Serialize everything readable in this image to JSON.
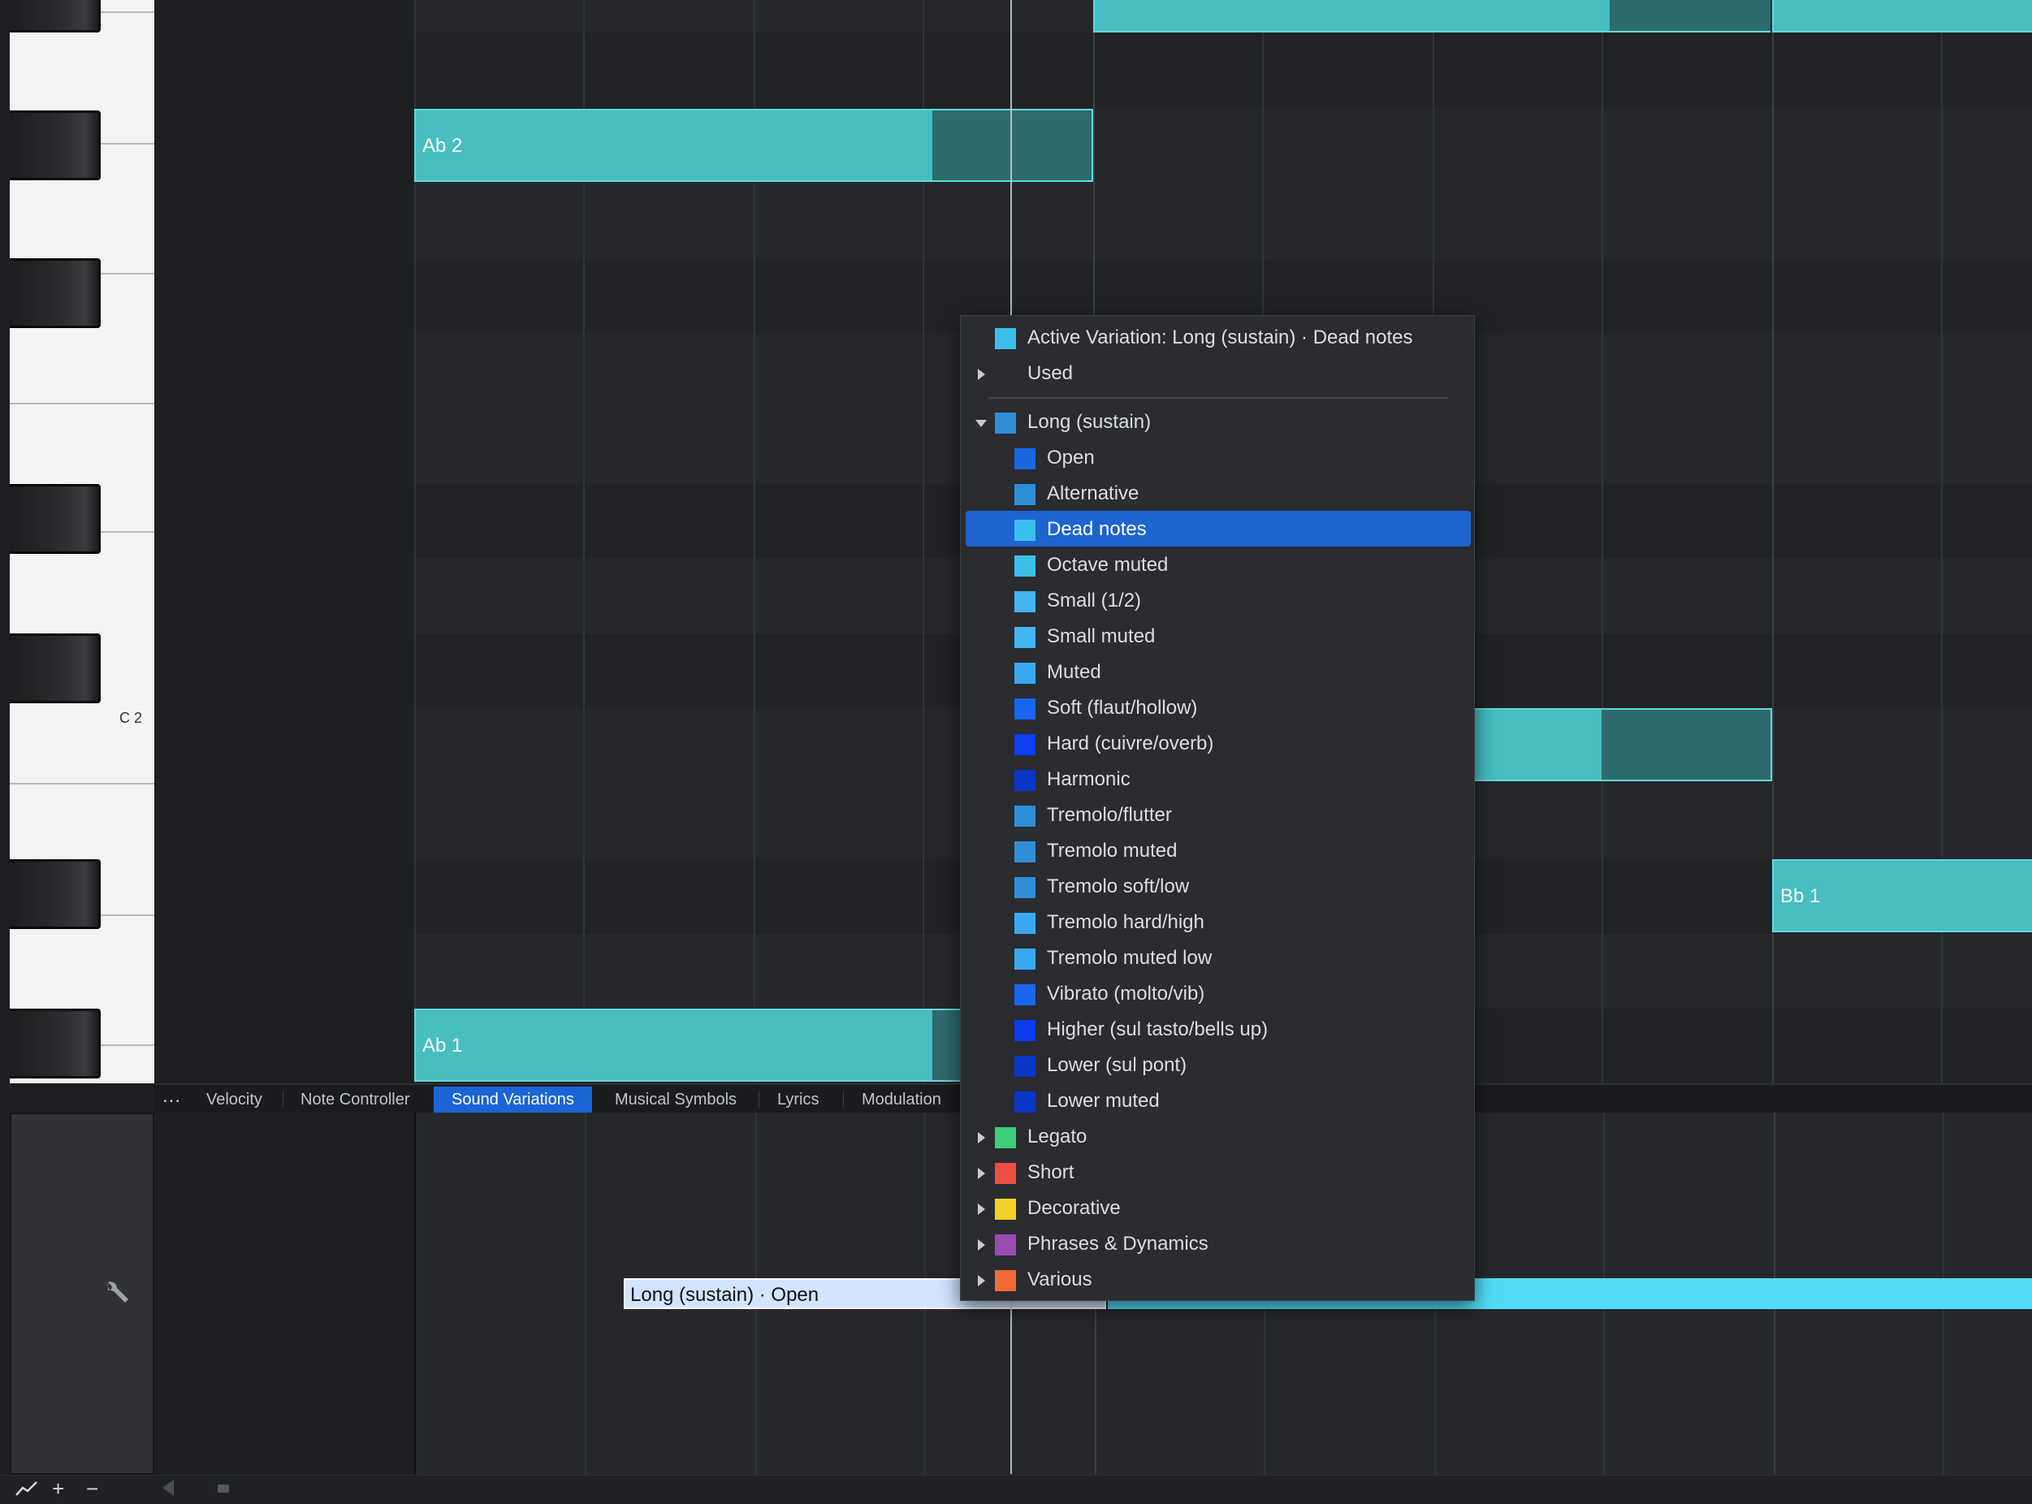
{
  "keyboard": {
    "c2_label": "C 2"
  },
  "notes": [
    {
      "label": "Ab 2",
      "pitch": "Ab 2"
    },
    {
      "label": "Ab 1",
      "pitch": "Ab 1"
    },
    {
      "label": "Bb 1",
      "pitch": "Bb 1"
    }
  ],
  "tabs": {
    "more": "...",
    "items": [
      "Velocity",
      "Note Controller",
      "Sound Variations",
      "Musical Symbols",
      "Lyrics",
      "Modulation"
    ],
    "active": "Sound Variations"
  },
  "lane": {
    "segment_a_label": "Long (sustain) · Open"
  },
  "menu": {
    "active_variation": "Active Variation: Long (sustain) · Dead notes",
    "used": "Used",
    "group_open": "Long (sustain)",
    "selected": "Dead notes",
    "sub_items": [
      {
        "label": "Open",
        "color": "#1a66e0"
      },
      {
        "label": "Alternative",
        "color": "#2e8ed6"
      },
      {
        "label": "Dead notes",
        "color": "#3cc0ea"
      },
      {
        "label": "Octave muted",
        "color": "#3cc0ea"
      },
      {
        "label": "Small (1/2)",
        "color": "#44b4f2"
      },
      {
        "label": "Small muted",
        "color": "#44b4f2"
      },
      {
        "label": "Muted",
        "color": "#3aa8f0"
      },
      {
        "label": "Soft (flaut/hollow)",
        "color": "#1566f0"
      },
      {
        "label": "Hard (cuivre/overb)",
        "color": "#0c3ef2"
      },
      {
        "label": "Harmonic",
        "color": "#0a36c8"
      },
      {
        "label": "Tremolo/flutter",
        "color": "#2e8ed6"
      },
      {
        "label": "Tremolo muted",
        "color": "#2e8ed6"
      },
      {
        "label": "Tremolo soft/low",
        "color": "#2e8ed6"
      },
      {
        "label": "Tremolo hard/high",
        "color": "#3aa8f0"
      },
      {
        "label": "Tremolo muted low",
        "color": "#3aa8f0"
      },
      {
        "label": "Vibrato (molto/vib)",
        "color": "#1a66f0"
      },
      {
        "label": "Higher (sul tasto/bells up)",
        "color": "#0a3cf0"
      },
      {
        "label": "Lower (sul pont)",
        "color": "#0a36c8"
      },
      {
        "label": "Lower muted",
        "color": "#0a36c8"
      }
    ],
    "groups": [
      {
        "label": "Legato",
        "color": "#3ecf7a"
      },
      {
        "label": "Short",
        "color": "#ee4f45"
      },
      {
        "label": "Decorative",
        "color": "#f4d02a"
      },
      {
        "label": "Phrases & Dynamics",
        "color": "#9a4bb0"
      },
      {
        "label": "Various",
        "color": "#f06a35"
      }
    ],
    "active_color": "#3cc0ea",
    "group_open_color": "#2e8ed6"
  },
  "toolbar": {
    "graph_icon": "line-graph-icon",
    "add_icon": "plus-icon",
    "remove_icon": "minus-icon"
  }
}
